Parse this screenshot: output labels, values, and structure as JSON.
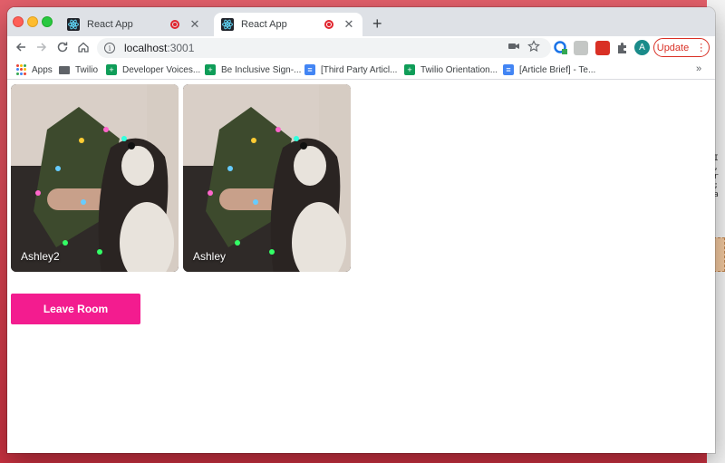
{
  "browser": {
    "tabs": [
      {
        "title": "React App",
        "active": false
      },
      {
        "title": "React App",
        "active": true
      }
    ],
    "newtab_label": "+",
    "url_host": "localhost",
    "url_port": ":3001",
    "update_label": "Update",
    "avatar_initial": "A"
  },
  "bookmarks": [
    {
      "label": "Apps",
      "icon": "apps-grid-icon"
    },
    {
      "label": "Twilio",
      "icon": "folder-icon"
    },
    {
      "label": "Developer Voices...",
      "icon": "google-sheets-icon"
    },
    {
      "label": "Be Inclusive Sign-...",
      "icon": "google-sheets-icon"
    },
    {
      "label": "[Third Party Articl...",
      "icon": "google-docs-icon"
    },
    {
      "label": "Twilio Orientation...",
      "icon": "google-sheets-icon"
    },
    {
      "label": "[Article Brief] - Te...",
      "icon": "google-docs-icon"
    }
  ],
  "bookmarks_more": "»",
  "room": {
    "participants": [
      {
        "name": "Ashley2"
      },
      {
        "name": "Ashley"
      }
    ],
    "leave_label": "Leave Room"
  },
  "colors": {
    "leave_button": "#f31c8f",
    "update_red": "#d93025",
    "desktop": "#d8414f"
  }
}
